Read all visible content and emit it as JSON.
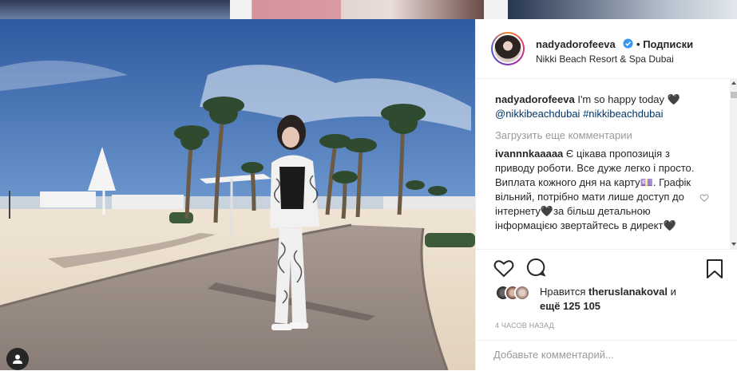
{
  "post": {
    "author": "nadyadorofeeva",
    "follow_separator": "•",
    "follow_label": "Подписки",
    "location": "Nikki Beach Resort & Spa Dubai"
  },
  "caption": {
    "username": "nadyadorofeeva",
    "text": "I'm so happy today 🖤",
    "tags": [
      "@nikkibeachdubai",
      "#nikkibeachdubai"
    ]
  },
  "load_more": "Загрузить еще комментарии",
  "comments": [
    {
      "username": "ivannnkaaaaa",
      "text": "Є цікава пропозиція з приводу роботи. Все дуже легко і просто. Виплата кожного дня на карту💷. Графік вільний, потрібно мати лише доступ до інтернету🖤за більш детальною інформацією звертайтесь в директ🖤"
    }
  ],
  "likes": {
    "prefix": "Нравится",
    "user": "theruslanakoval",
    "suffix": "и",
    "more": "ещё 125 105"
  },
  "timestamp": "4 ЧАСОВ НАЗАД",
  "add_comment": {
    "placeholder": "Добавьте комментарий..."
  },
  "colors": {
    "link": "#003569",
    "muted": "#999999",
    "verified": "#3897f0"
  },
  "icons": [
    "heart-icon",
    "comment-icon",
    "share-icon",
    "bookmark-icon",
    "user-tag-icon",
    "verified-badge-icon"
  ]
}
